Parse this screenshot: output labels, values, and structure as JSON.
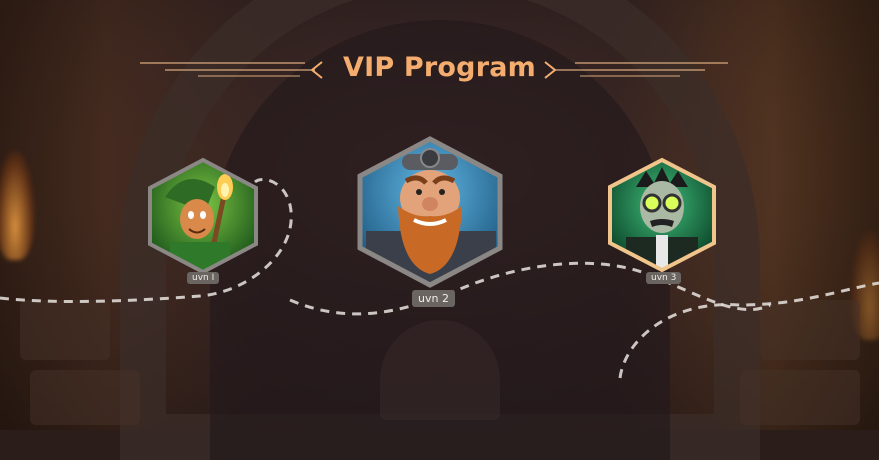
{
  "header": {
    "title": "VIP Program"
  },
  "levels": [
    {
      "label": "uvn I",
      "character": "leprechaun-with-torch"
    },
    {
      "label": "uvn 2",
      "character": "bearded-dwarf"
    },
    {
      "label": "uvn 3",
      "character": "scientist-with-goggles"
    }
  ],
  "colors": {
    "accent": "#f4ad6e",
    "frame_gray": "#8a8784",
    "frame_gold": "#f1c48b",
    "badge_bg": "#6a6560",
    "path_dash": "#e9e4df"
  }
}
